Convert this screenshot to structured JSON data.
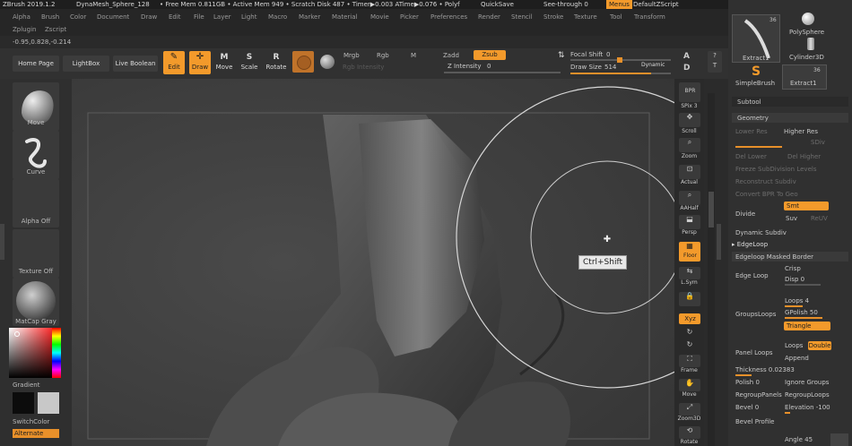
{
  "titlebar": {
    "app": "ZBrush 2019.1.2",
    "doc": "DynaMesh_Sphere_128",
    "mem": "• Free Mem 0.811GB • Active Mem 949 • Scratch Disk 487 • Timer▶0.003 ATime▶0.076 • Polyf",
    "quicksave": "QuickSave",
    "seethrough": "See-through",
    "seethrough_value": "0",
    "menus": "Menus",
    "script": "DefaultZScript"
  },
  "menus": [
    "Alpha",
    "Brush",
    "Color",
    "Document",
    "Draw",
    "Edit",
    "File",
    "Layer",
    "Light",
    "Macro",
    "Marker",
    "Material",
    "Movie",
    "Picker",
    "Preferences",
    "Render",
    "Stencil",
    "Stroke",
    "Texture",
    "Tool",
    "Transform"
  ],
  "menus2": [
    "Zplugin",
    "Zscript"
  ],
  "coords": "-0.95,0.828,-0.214",
  "shelf": {
    "home": "Home Page",
    "lightbox": "LightBox",
    "liveboolean": "Live Boolean",
    "edit": "Edit",
    "draw": "Draw",
    "move": "Move",
    "scale": "Scale",
    "rotate": "Rotate",
    "mrgb": "Mrgb",
    "rgb": "Rgb",
    "m": "M",
    "zadd": "Zadd",
    "zsub": "Zsub",
    "rgb_intensity": "Rgb Intensity",
    "z_intensity": "Z Intensity",
    "z_intensity_value": "0",
    "focal_shift": "Focal Shift",
    "focal_shift_value": "0",
    "draw_size": "Draw Size",
    "draw_size_value": "514",
    "dynamic": "Dynamic"
  },
  "left": {
    "brush": "Move",
    "stroke": "Curve",
    "alpha": "Alpha Off",
    "texture": "Texture Off",
    "material": "MatCap Gray",
    "gradient": "Gradient",
    "switchcolor": "SwitchColor",
    "alternate": "Alternate"
  },
  "right": {
    "bpr": "BPR",
    "spix": "SPix 3",
    "scroll": "Scroll",
    "zoom": "Zoom",
    "actual": "Actual",
    "aahalf": "AAHalf",
    "persp": "Persp",
    "floor": "Floor",
    "lsym": "L.Sym",
    "xyz": "Xyz",
    "frame": "Frame",
    "move": "Move",
    "zoom3d": "Zoom3D",
    "rotate": "Rotate"
  },
  "tooltip": "Ctrl+Shift",
  "tray": {
    "num1": "36",
    "polysphere": "PolySphere",
    "extract_a": "Extract1",
    "cylinder": "Cylinder3D",
    "simplebrush": "SimpleBrush",
    "num2": "36",
    "extract_b": "Extract1",
    "subtool": "Subtool",
    "geometry": "Geometry",
    "lower_res": "Lower Res",
    "higher_res": "Higher Res",
    "sdiv": "SDiv",
    "del_lower": "Del Lower",
    "del_higher": "Del Higher",
    "freeze": "Freeze SubDivision Levels",
    "reconstruct": "Reconstruct Subdiv",
    "convert": "Convert BPR To Geo",
    "divide": "Divide",
    "smt": "Smt",
    "suv": "Suv",
    "reuv": "ReUV",
    "dynamic_subdiv": "Dynamic Subdiv",
    "edgeloop": "EdgeLoop",
    "edgeloop_masked": "Edgeloop Masked Border",
    "edge_loop": "Edge Loop",
    "crisp": "Crisp",
    "disp": "Disp",
    "disp_value": "0",
    "groupsloops": "GroupsLoops",
    "loops": "Loops",
    "loops_value": "4",
    "gpolish": "GPolish",
    "gpolish_value": "50",
    "triangle": "Triangle",
    "panel_loops": "Panel Loops",
    "loops2": "Loops",
    "double": "Double",
    "append": "Append",
    "thickness": "Thickness",
    "thickness_value": "0.02383",
    "polish": "Polish",
    "polish_value": "0",
    "ignore_groups": "Ignore Groups",
    "regroup_panels": "RegroupPanels",
    "regroup_loops": "RegroupLoops",
    "bevel": "Bevel",
    "bevel_value": "0",
    "elevation": "Elevation",
    "elevation_value": "-100",
    "bevel_profile": "Bevel Profile",
    "angle": "Angle",
    "angle_value": "45"
  },
  "colors": {
    "accent": "#f39a2b",
    "panel": "#303030",
    "canvas": "#3a3a3a"
  }
}
